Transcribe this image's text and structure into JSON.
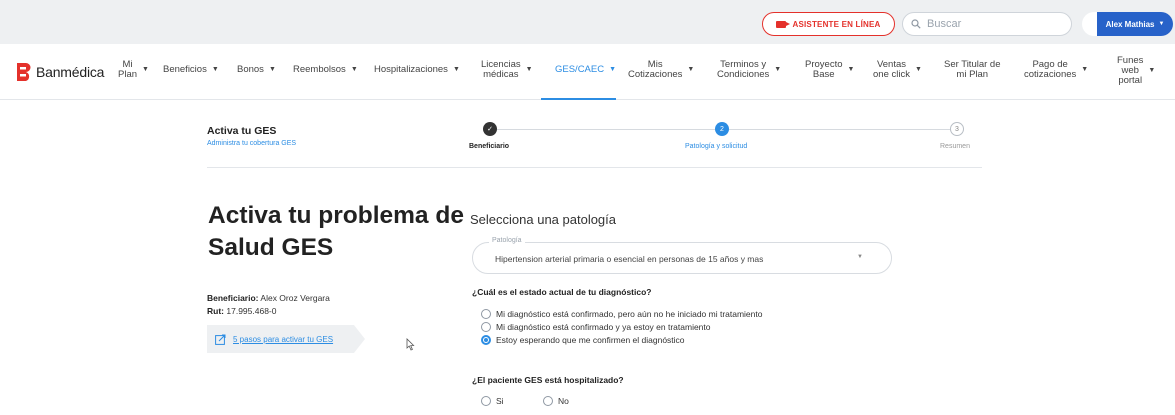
{
  "topbar": {
    "asistente_label": "ASISTENTE EN LÍNEA",
    "search_placeholder": "Buscar",
    "user_name": "Alex Mathias"
  },
  "brand": {
    "name": "Banmédica",
    "color": "#e4312b",
    "accent": "#2c8de3"
  },
  "nav": {
    "items": [
      {
        "label": "Mi\nPlan"
      },
      {
        "label": "Beneficios"
      },
      {
        "label": "Bonos"
      },
      {
        "label": "Reembolsos"
      },
      {
        "label": "Hospitalizaciones"
      },
      {
        "label": "Licencias\nmédicas"
      },
      {
        "label": "GES/CAEC"
      },
      {
        "label": "Mis\nCotizaciones"
      },
      {
        "label": "Terminos y\nCondiciones"
      },
      {
        "label": "Proyecto\nBase"
      },
      {
        "label": "Ventas\none click"
      },
      {
        "label": "Ser Titular de\nmi Plan"
      },
      {
        "label": "Pago de\ncotizaciones"
      },
      {
        "label": "Funes\nweb\nportal"
      }
    ],
    "active": "GES/CAEC"
  },
  "stepper": {
    "title": "Activa tu GES",
    "subtitle": "Administra tu cobertura GES",
    "steps": [
      {
        "number": "✓",
        "label": "Beneficiario",
        "state": "done"
      },
      {
        "number": "2",
        "label": "Patología y solicitud",
        "state": "current"
      },
      {
        "number": "3",
        "label": "Resumen",
        "state": "pending"
      }
    ]
  },
  "main": {
    "title": "Activa tu problema de Salud GES",
    "beneficiario_label": "Beneficiario:",
    "beneficiario_value": "Alex Oroz Vergara",
    "rut_label": "Rut:",
    "rut_value": "17.995.468-0",
    "pasos_link": "5 pasos para activar tu GES"
  },
  "form": {
    "select_title": "Selecciona una patología",
    "select_label": "Patología",
    "select_value": "Hipertension arterial primaria o esencial en personas de 15 años y mas",
    "q1": "¿Cuál es el estado actual de tu diagnóstico?",
    "q1_options": [
      "Mi diagnóstico está confirmado, pero aún no he iniciado mi tratamiento",
      "Mi diagnóstico está confirmado y ya estoy en tratamiento",
      "Estoy esperando que me confirmen el diagnóstico"
    ],
    "q1_selected": 2,
    "q2": "¿El paciente GES está hospitalizado?",
    "q2_options": [
      "Si",
      "No"
    ]
  }
}
